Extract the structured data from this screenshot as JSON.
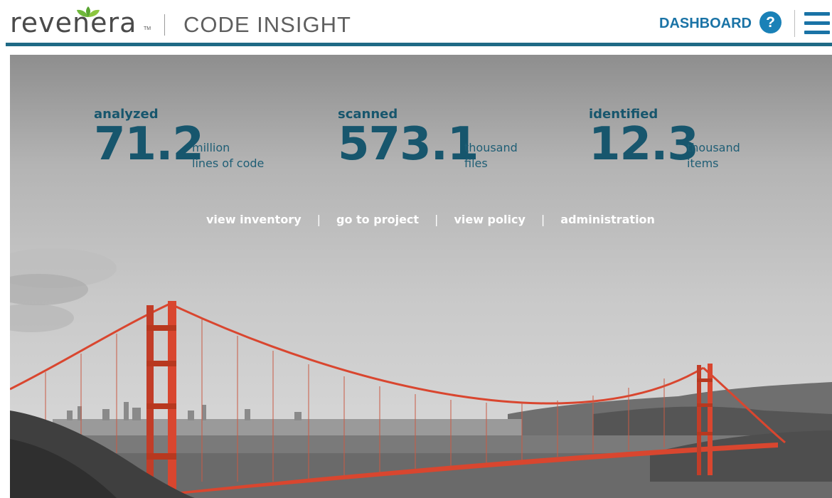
{
  "header": {
    "logo_text": "revenera",
    "logo_tm": "TM",
    "product_name": "CODE INSIGHT",
    "nav_dashboard": "DASHBOARD",
    "help_glyph": "?",
    "icons": [
      "leaf-logo-icon",
      "help-icon",
      "menu-icon"
    ],
    "colors": {
      "brand_blue": "#1a73a6",
      "rule": "#1f6a86",
      "logo_green": "#7ac143"
    }
  },
  "stats": [
    {
      "label": "analyzed",
      "value": "71.2",
      "unit_line1": "million",
      "unit_line2": "lines of code"
    },
    {
      "label": "scanned",
      "value": "573.1",
      "unit_line1": "thousand",
      "unit_line2": "files"
    },
    {
      "label": "identified",
      "value": "12.3",
      "unit_line1": "thousand",
      "unit_line2": "items"
    }
  ],
  "links": {
    "items": [
      "view inventory",
      "go to project",
      "view policy",
      "administration"
    ],
    "separator": "|"
  },
  "hero": {
    "bridge_color": "#d9462f",
    "stat_color": "#17566d"
  }
}
